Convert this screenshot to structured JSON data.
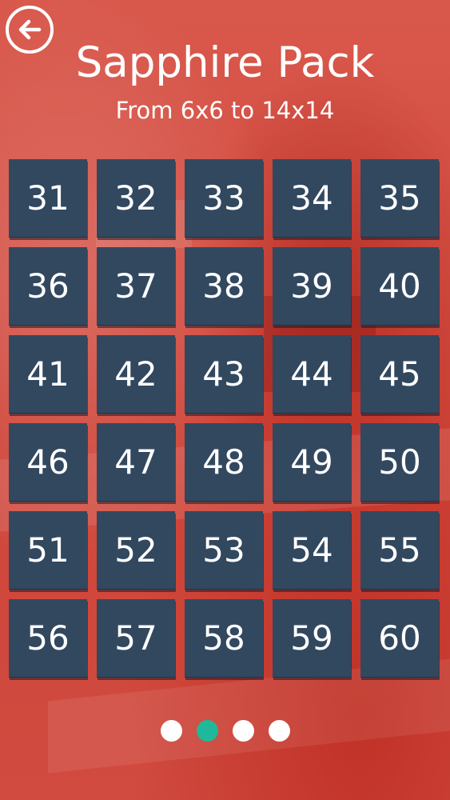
{
  "header": {
    "title": "Sapphire Pack",
    "subtitle": "From 6x6 to 14x14",
    "back_icon": "arrow-left-icon"
  },
  "levels": [
    "31",
    "32",
    "33",
    "34",
    "35",
    "36",
    "37",
    "38",
    "39",
    "40",
    "41",
    "42",
    "43",
    "44",
    "45",
    "46",
    "47",
    "48",
    "49",
    "50",
    "51",
    "52",
    "53",
    "54",
    "55",
    "56",
    "57",
    "58",
    "59",
    "60"
  ],
  "pagination": {
    "page_count": 4,
    "active_index": 1
  },
  "colors": {
    "background": "#d3473b",
    "tile": "#32485f",
    "tile_text": "#ffffff",
    "active_dot": "#1fb89a",
    "inactive_dot": "#ffffff"
  }
}
